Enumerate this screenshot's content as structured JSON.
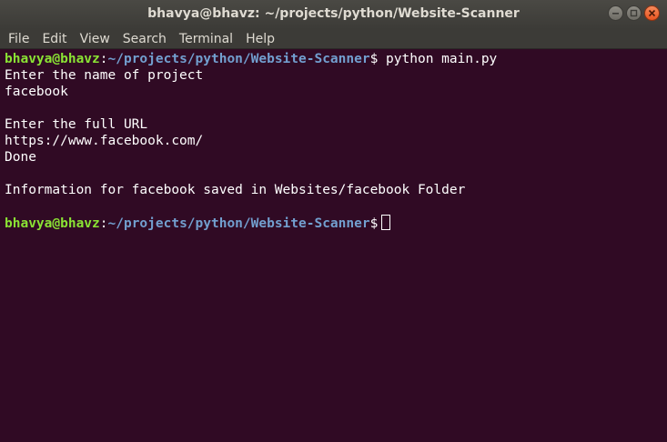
{
  "window": {
    "title": "bhavya@bhavz: ~/projects/python/Website-Scanner"
  },
  "menu": [
    "File",
    "Edit",
    "View",
    "Search",
    "Terminal",
    "Help"
  ],
  "prompt": {
    "user_host": "bhavya@bhavz",
    "colon": ":",
    "path": "~/projects/python/Website-Scanner",
    "symbol": "$"
  },
  "terminal": {
    "command": " python main.py",
    "output": [
      "Enter the name of project",
      "facebook",
      "",
      "Enter the full URL",
      "https://www.facebook.com/",
      "Done",
      "",
      "Information for facebook saved in Websites/facebook Folder",
      ""
    ]
  },
  "colors": {
    "background": "#300a24",
    "prompt_user": "#8ae234",
    "prompt_path": "#729fcf",
    "text": "#ffffff",
    "titlebar": "#3c3b37"
  }
}
